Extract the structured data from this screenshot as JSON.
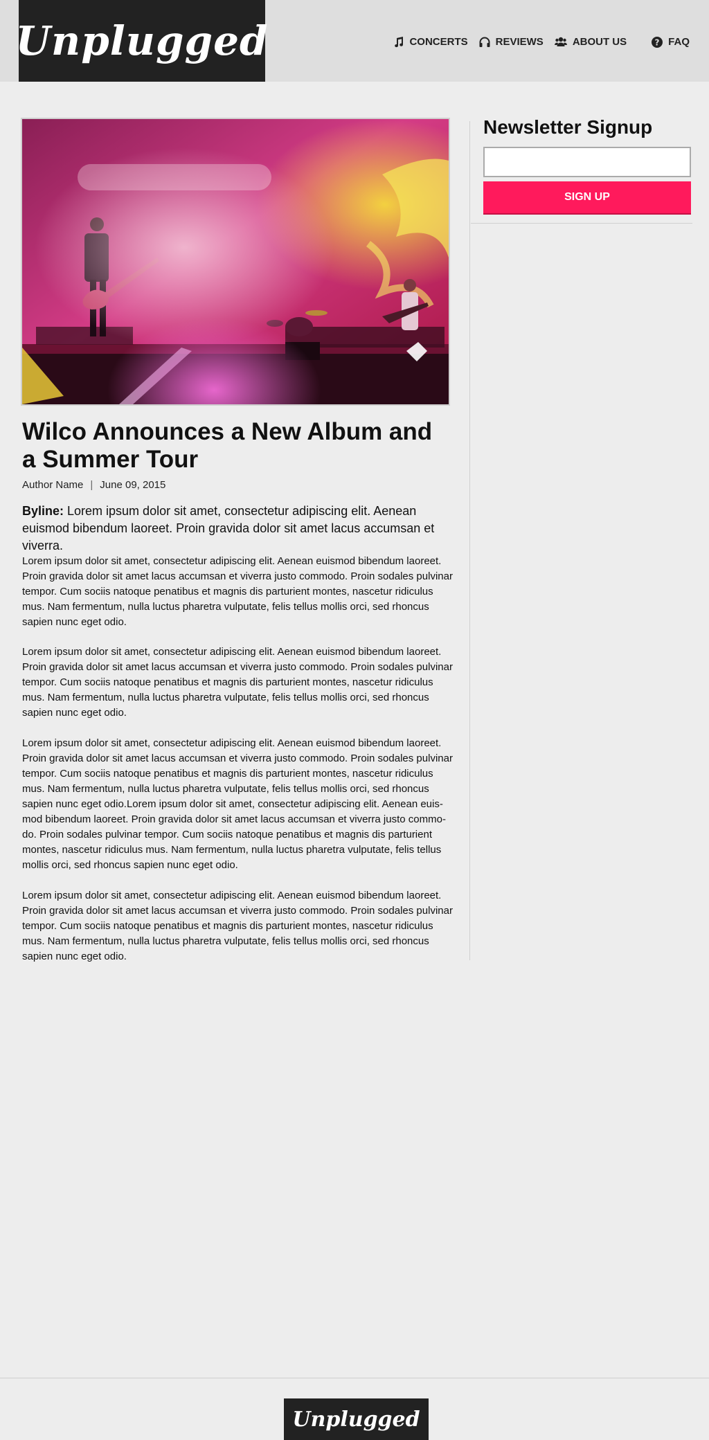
{
  "site": {
    "logo": "Unplugged",
    "footer_logo": "Unplugged"
  },
  "nav": [
    {
      "label": "CONCERTS",
      "icon": "music-note-icon"
    },
    {
      "label": "REVIEWS",
      "icon": "headphones-icon"
    },
    {
      "label": "ABOUT US",
      "icon": "users-icon"
    },
    {
      "label": "FAQ",
      "icon": "question-circle-icon"
    }
  ],
  "article": {
    "title": "Wilco Announces a New Album and a Summer Tour",
    "author": "Author Name",
    "separator": "|",
    "date": "June 09, 2015",
    "byline_label": "Byline:",
    "byline_text": " Lorem ipsum dolor sit amet, consectetur adipiscing elit. Aenean euismod bibendum laoreet. Proin gravida dolor sit amet lacus accumsan et viverra.",
    "paragraphs": [
      "Lorem ipsum dolor sit amet, consectetur adipiscing elit. Aenean euismod bibendum laoreet. Proin gravida dolor sit amet lacus accumsan et viverra justo commodo. Proin sodales pulvinar tempor. Cum sociis natoque penatibus et magnis dis parturient montes, nascetur ridiculus mus. Nam fermentum, nulla luctus pharetra vulputate, felis tellus mollis orci, sed rhoncus sapien nunc eget odio.",
      "Lorem ipsum dolor sit amet, consectetur adipiscing elit. Aenean euismod bibendum laoreet. Proin gravida dolor sit amet lacus accumsan et viverra justo commodo. Proin sodales pulvinar tempor. Cum sociis natoque penatibus et magnis dis parturient montes, nascetur ridiculus mus. Nam fermentum, nulla luctus pharetra vulputate, felis tellus mollis orci, sed rhoncus sapien nunc eget odio.",
      "Lorem ipsum dolor sit amet, consectetur adipiscing elit. Aenean euismod bibendum laoreet. Proin gravida dolor sit amet lacus accumsan et viverra justo commodo. Proin sodales pulvinar tempor. Cum sociis natoque penatibus et magnis dis parturient montes, nascetur ridiculus mus. Nam fermentum, nulla luctus pharetra vulputate, felis tellus mollis orci, sed rhoncus sapien nunc eget odio.Lorem ipsum dolor sit amet, consectetur adipiscing elit. Aenean euis-mod bibendum laoreet. Proin gravida dolor sit amet lacus accumsan et viverra justo commo-do. Proin sodales pulvinar tempor. Cum sociis natoque penatibus et magnis dis parturient montes, nascetur ridiculus mus. Nam fermentum, nulla luctus pharetra vulputate, felis tellus mollis orci, sed rhoncus sapien nunc eget odio.",
      "Lorem ipsum dolor sit amet, consectetur adipiscing elit. Aenean euismod bibendum laoreet. Proin gravida dolor sit amet lacus accumsan et viverra justo commodo. Proin sodales pulvinar tempor. Cum sociis natoque penatibus et magnis dis parturient montes, nascetur ridiculus mus. Nam fermentum, nulla luctus pharetra vulputate, felis tellus mollis orci, sed rhoncus sapien nunc eget odio."
    ]
  },
  "sidebar": {
    "newsletter_title": "Newsletter Signup",
    "email_value": "",
    "signup_label": "SIGN UP"
  },
  "colors": {
    "accent": "#ff1a5c",
    "dark": "#222222",
    "background": "#ededed"
  }
}
